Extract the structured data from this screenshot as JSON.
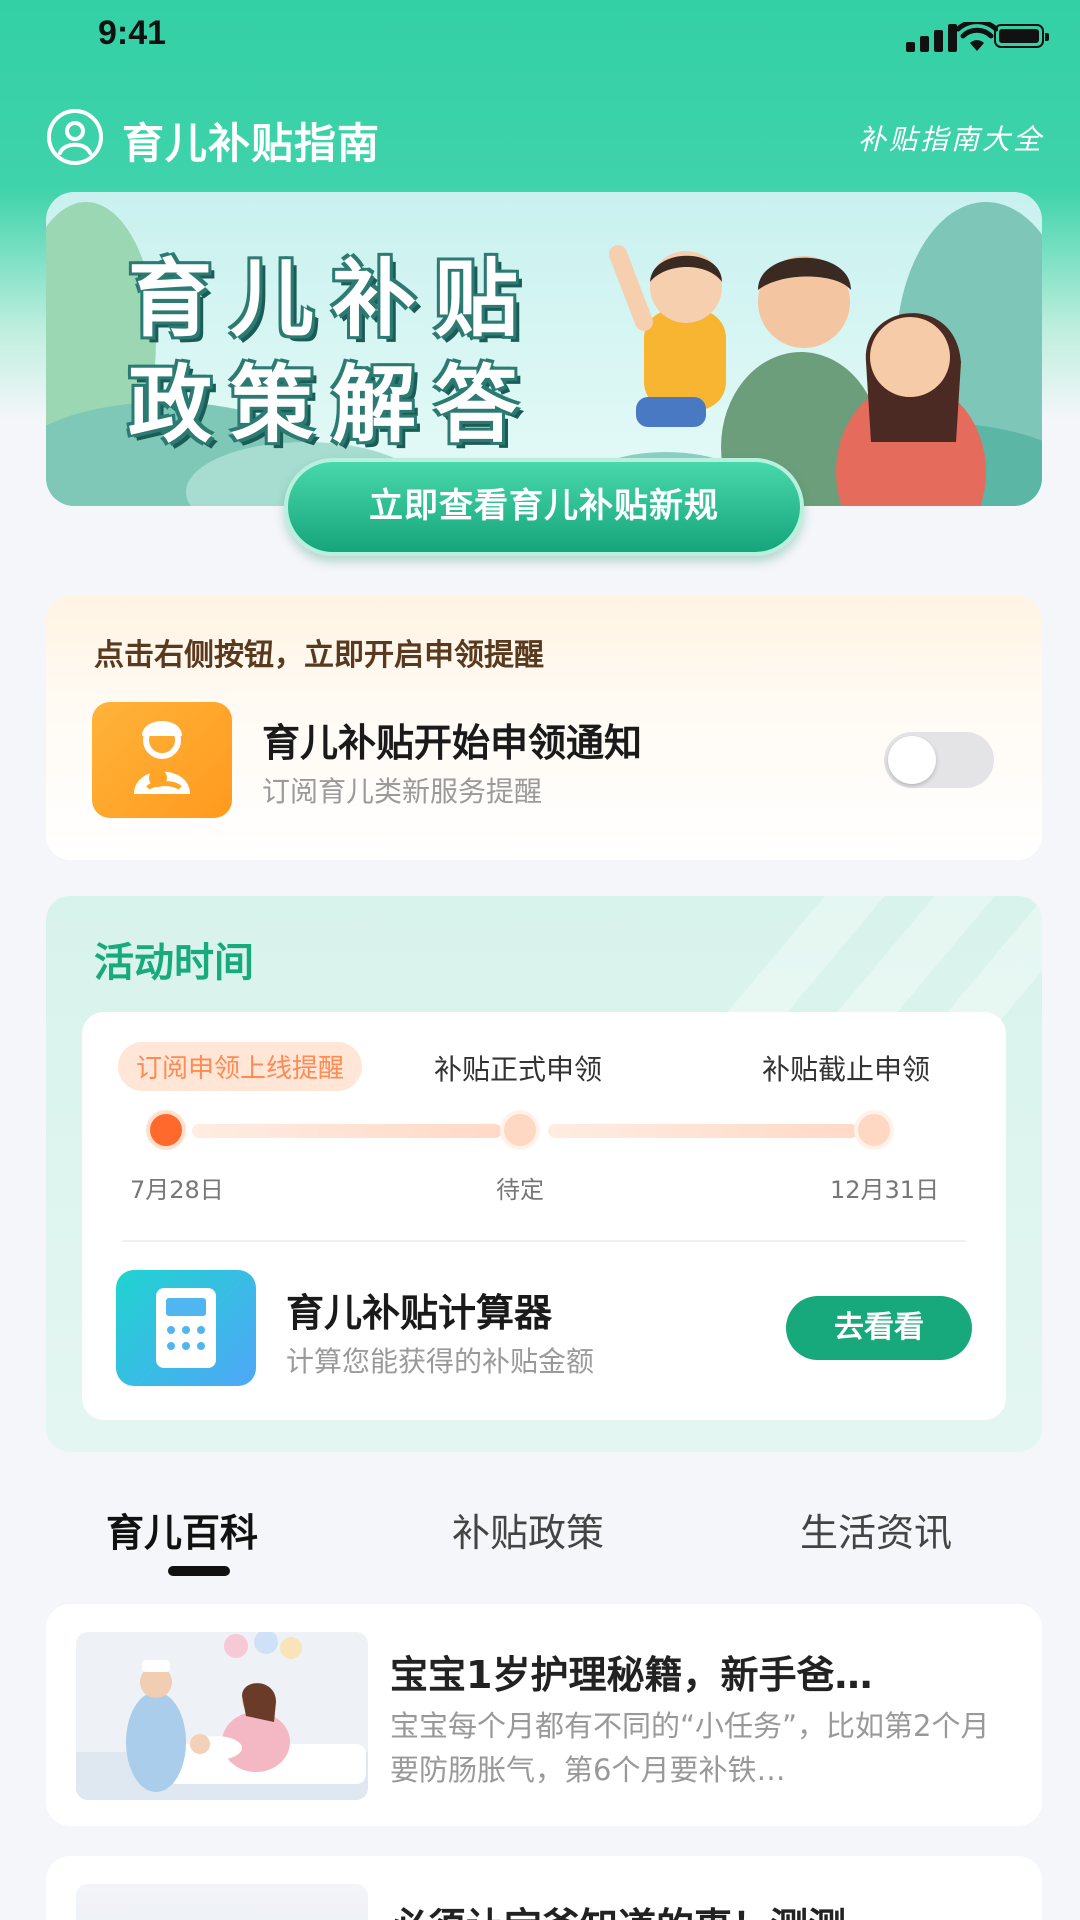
{
  "status_bar": {
    "time": "9:41"
  },
  "app_bar": {
    "title": "育儿补贴指南",
    "subtitle": "补贴指南大全"
  },
  "banner": {
    "line1": "育儿补贴",
    "line2": "政策解答",
    "cta_label": "立即查看育儿补贴新规"
  },
  "reminder": {
    "hint": "点击右侧按钮，立即开启申领提醒",
    "title": "育儿补贴开始申领通知",
    "subtitle": "订阅育儿类新服务提醒",
    "toggle_on": false
  },
  "activity": {
    "title": "活动时间",
    "steps": [
      {
        "label": "订阅申领上线提醒",
        "date": "7月28日",
        "active": true
      },
      {
        "label": "补贴正式申领",
        "date": "待定",
        "active": false
      },
      {
        "label": "补贴截止申领",
        "date": "12月31日",
        "active": false
      }
    ],
    "calculator": {
      "title": "育儿补贴计算器",
      "subtitle": "计算您能获得的补贴金额",
      "button": "去看看"
    }
  },
  "tabs": [
    {
      "label": "育儿百科",
      "active": true
    },
    {
      "label": "补贴政策",
      "active": false
    },
    {
      "label": "生活资讯",
      "active": false
    }
  ],
  "articles": [
    {
      "title": "宝宝1岁护理秘籍，新手爸…",
      "body": "宝宝每个月都有不同的“小任务”，比如第2个月要防肠胀气，第6个月要补铁…"
    },
    {
      "title": "必须让宝爸知道的事！测测"
    }
  ],
  "colors": {
    "brand_green": "#17a87b",
    "header_green": "#33d0a5",
    "orange": "#ff9a1e",
    "accent_orange": "#ff6a2c"
  }
}
